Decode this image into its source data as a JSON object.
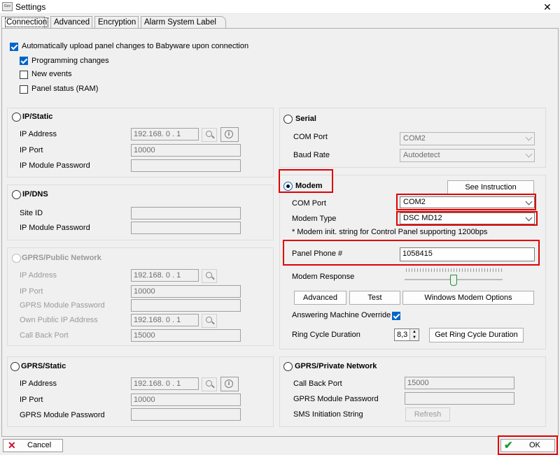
{
  "window": {
    "title": "Settings",
    "close_glyph": "✕",
    "app_icon_text": "Gov"
  },
  "tabs": [
    {
      "label": "Connection",
      "active": true
    },
    {
      "label": "Advanced"
    },
    {
      "label": "Encryption"
    },
    {
      "label": "Alarm System Label"
    }
  ],
  "auto_upload": {
    "label": "Automatically upload panel changes to Babyware upon connection",
    "checked": true,
    "options": [
      {
        "label": "Programming changes",
        "checked": true
      },
      {
        "label": "New events",
        "checked": false
      },
      {
        "label": "Panel status (RAM)",
        "checked": false
      }
    ]
  },
  "ip_static": {
    "title": "IP/Static",
    "ip_label": "IP Address",
    "ip_value": "192.168. 0 . 1",
    "port_label": "IP Port",
    "port_value": "10000",
    "pw_label": "IP Module Password",
    "pw_value": ""
  },
  "ip_dns": {
    "title": "IP/DNS",
    "site_label": "Site ID",
    "site_value": "",
    "pw_label": "IP Module Password",
    "pw_value": ""
  },
  "gprs_public": {
    "title": "GPRS/Public Network",
    "ip_label": "IP Address",
    "ip_value": "192.168. 0 . 1",
    "port_label": "IP Port",
    "port_value": "10000",
    "pw_label": "GPRS Module Password",
    "pw_value": "",
    "own_ip_label": "Own Public IP Address",
    "own_ip_value": "192.168. 0 . 1",
    "callback_label": "Call Back Port",
    "callback_value": "15000"
  },
  "gprs_static": {
    "title": "GPRS/Static",
    "ip_label": "IP Address",
    "ip_value": "192.168. 0 . 1",
    "port_label": "IP Port",
    "port_value": "10000",
    "pw_label": "GPRS Module Password",
    "pw_value": ""
  },
  "serial": {
    "title": "Serial",
    "com_label": "COM Port",
    "com_value": "COM2",
    "baud_label": "Baud Rate",
    "baud_value": "Autodetect"
  },
  "modem": {
    "title": "Modem",
    "see_instruction": "See Instruction",
    "com_label": "COM Port",
    "com_value": "COM2",
    "type_label": "Modem Type",
    "type_value": "DSC MD12",
    "note": "* Modem init. string for Control Panel supporting 1200bps",
    "phone_label": "Panel Phone #",
    "phone_value": "1058415",
    "response_label": "Modem Response",
    "response_level_fraction": 0.5,
    "btn_advanced": "Advanced",
    "btn_test": "Test",
    "btn_windows": "Windows Modem Options",
    "ans_label": "Answering Machine Override",
    "ans_checked": true,
    "ring_label": "Ring Cycle Duration",
    "ring_value": "8,3",
    "btn_ring": "Get Ring Cycle Duration"
  },
  "gprs_private": {
    "title": "GPRS/Private Network",
    "callback_label": "Call Back Port",
    "callback_value": "15000",
    "pw_label": "GPRS Module Password",
    "pw_value": "",
    "sms_label": "SMS Initiation String",
    "btn_refresh": "Refresh"
  },
  "footer": {
    "cancel": "Cancel",
    "ok": "OK"
  },
  "colors": {
    "highlight": "#e00000",
    "check_blue": "#0065c8",
    "ok_green": "#1f9a2f",
    "cancel_red": "#c8102e"
  }
}
